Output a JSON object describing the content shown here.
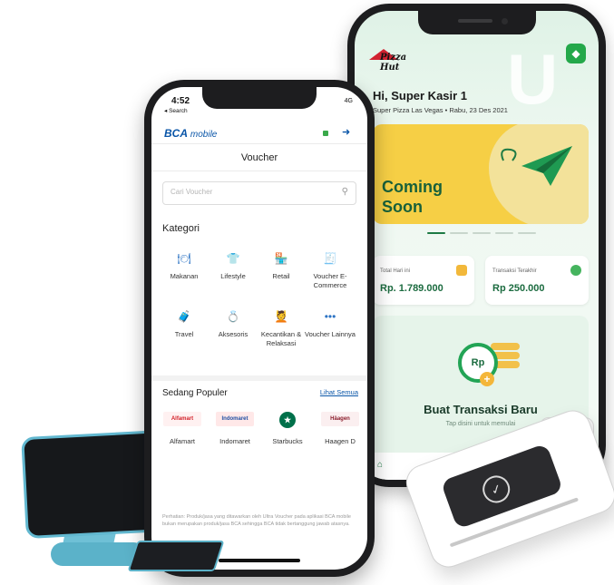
{
  "pos_app": {
    "brand_logo": "Pizza Hut",
    "greeting": "Hi, Super Kasir 1",
    "subtitle": "Super Pizza Las Vegas • Rabu, 23 Des 2021",
    "banner": {
      "line1": "Coming",
      "line2": "Soon"
    },
    "stats": [
      {
        "label": "Total Hari ini",
        "value": "Rp. 1.789.000"
      },
      {
        "label": "Transaksi Terakhir",
        "value": "Rp 250.000"
      }
    ],
    "cta": {
      "badge": "Rp",
      "title": "Buat Transaksi Baru",
      "subtitle": "Tap disini untuk memulai"
    }
  },
  "bca_app": {
    "status_time": "4:52",
    "status_back": "◂ Search",
    "status_right": "4G",
    "brand": "BCA",
    "brand_suffix": "mobile",
    "page_title": "Voucher",
    "search_placeholder": "Cari Voucher",
    "category_heading": "Kategori",
    "categories": [
      {
        "icon": "🍽",
        "label": "Makanan"
      },
      {
        "icon": "👕",
        "label": "Lifestyle"
      },
      {
        "icon": "🏪",
        "label": "Retail"
      },
      {
        "icon": "🧾",
        "label": "Voucher E-Commerce"
      },
      {
        "icon": "🧳",
        "label": "Travel"
      },
      {
        "icon": "💍",
        "label": "Aksesoris"
      },
      {
        "icon": "💆",
        "label": "Kecantikan & Relaksasi"
      },
      {
        "icon": "•••",
        "label": "Voucher Lainnya"
      }
    ],
    "popular_heading": "Sedang Populer",
    "see_all": "Lihat Semua",
    "brands": [
      {
        "logo": "Alfamart",
        "label": "Alfamart",
        "color": "#d3222a"
      },
      {
        "logo": "Indomaret",
        "label": "Indomaret",
        "color": "#1f4fa3"
      },
      {
        "logo": "★",
        "label": "Starbucks",
        "color": "#00704a"
      },
      {
        "logo": "Häagen",
        "label": "Haagen D",
        "color": "#8a1c2b"
      }
    ],
    "disclaimer": "Perhatian: Produk/jasa yang ditawarkan oleh Ultra Voucher pada aplikasi BCA mobile bukan merupakan produk/jasa BCA sehingga BCA tidak bertanggung jawab atasnya."
  },
  "colors": {
    "pos_green": "#1b6b3f",
    "banner_yellow": "#f6cf45",
    "bca_blue": "#0a56a8",
    "stand_teal": "#5bb2c9"
  }
}
